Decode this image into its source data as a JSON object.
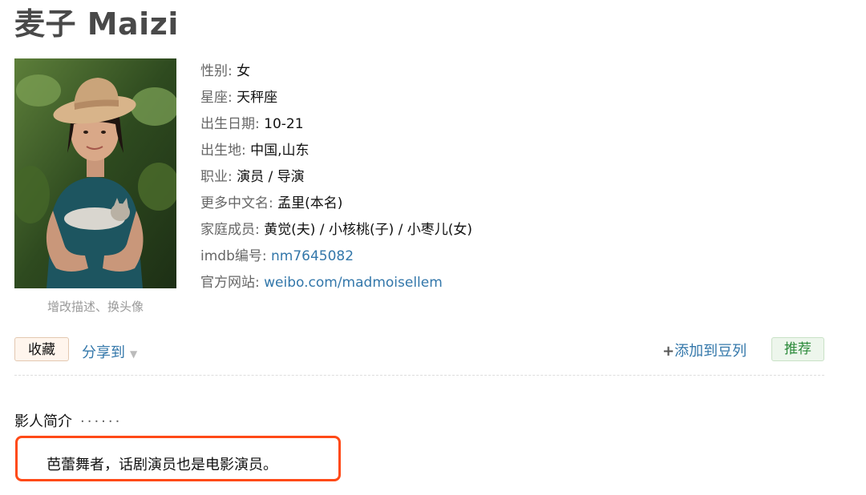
{
  "header": {
    "title": "麦子 Maizi"
  },
  "photo": {
    "caption": "增改描述、换头像"
  },
  "info": {
    "gender": {
      "label": "性别",
      "value": "女"
    },
    "zodiac": {
      "label": "星座",
      "value": "天秤座"
    },
    "birthdate": {
      "label": "出生日期",
      "value": "10-21"
    },
    "birthplace": {
      "label": "出生地",
      "value": "中国,山东"
    },
    "occupation": {
      "label": "职业",
      "value": "演员 / 导演"
    },
    "other_names": {
      "label": "更多中文名",
      "value": "孟里(本名)"
    },
    "family": {
      "label": "家庭成员",
      "value": "黄觉(夫) / 小核桃(子) / 小枣儿(女)"
    },
    "imdb": {
      "label": "imdb编号",
      "value": "nm7645082"
    },
    "website": {
      "label": "官方网站",
      "value": "weibo.com/madmoisellem"
    }
  },
  "actions": {
    "collect": "收藏",
    "share": "分享到",
    "add_doulist": "添加到豆列",
    "recommend": "推荐"
  },
  "intro": {
    "heading": "影人简介",
    "dots": "······",
    "text": "芭蕾舞者，话剧演员也是电影演员。"
  },
  "colors": {
    "link": "#3377aa",
    "highlight_border": "#ff4a17",
    "recommend": "#2b8a3a"
  }
}
